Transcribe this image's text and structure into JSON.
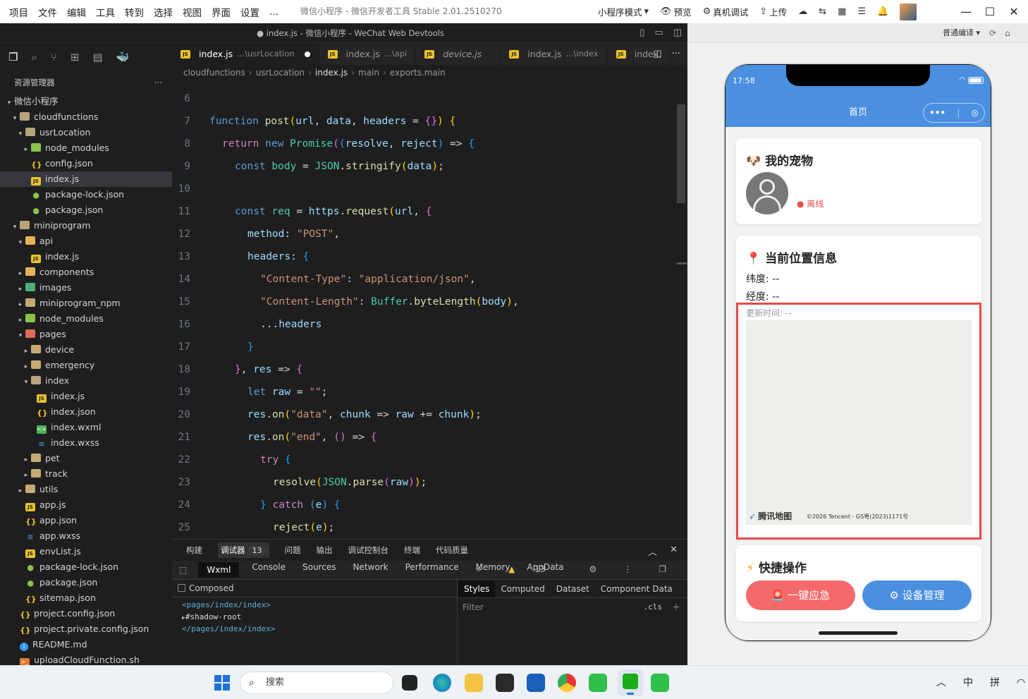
{
  "titlebar": {
    "menu": [
      "项目",
      "文件",
      "编辑",
      "工具",
      "转到",
      "选择",
      "视图",
      "界面",
      "设置",
      "..."
    ],
    "title": "微信小程序 - 微信开发者工具 Stable 2.01.2510270",
    "mode": "小程序模式",
    "preview": "预览",
    "real_debug": "真机调试",
    "upload": "上传"
  },
  "subbar": {
    "title": "● index.js - 微信小程序 - WeChat Web Devtools"
  },
  "simulator_top": {
    "compile": "普通编译"
  },
  "explorer": {
    "header": "资源管理器",
    "more": "···",
    "items": [
      {
        "label": "微信小程序",
        "depth": 0,
        "twisty": "▾",
        "icon": "none"
      },
      {
        "label": "cloudfunctions",
        "depth": 1,
        "twisty": "▾",
        "icon": "folder-open"
      },
      {
        "label": "usrLocation",
        "depth": 2,
        "twisty": "▾",
        "icon": "folder-open"
      },
      {
        "label": "node_modules",
        "depth": 3,
        "twisty": "▸",
        "icon": "folder-node"
      },
      {
        "label": "config.json",
        "depth": 3,
        "twisty": "",
        "icon": "json"
      },
      {
        "label": "index.js",
        "depth": 3,
        "twisty": "",
        "icon": "js",
        "selected": true
      },
      {
        "label": "package-lock.json",
        "depth": 3,
        "twisty": "",
        "icon": "pkg"
      },
      {
        "label": "package.json",
        "depth": 3,
        "twisty": "",
        "icon": "pkg"
      },
      {
        "label": "miniprogram",
        "depth": 1,
        "twisty": "▾",
        "icon": "folder-open"
      },
      {
        "label": "api",
        "depth": 2,
        "twisty": "▾",
        "icon": "api-folder"
      },
      {
        "label": "index.js",
        "depth": 3,
        "twisty": "",
        "icon": "js"
      },
      {
        "label": "components",
        "depth": 2,
        "twisty": "▸",
        "icon": "api-folder"
      },
      {
        "label": "images",
        "depth": 2,
        "twisty": "▸",
        "icon": "img-folder"
      },
      {
        "label": "miniprogram_npm",
        "depth": 2,
        "twisty": "▸",
        "icon": "folder"
      },
      {
        "label": "node_modules",
        "depth": 2,
        "twisty": "▸",
        "icon": "folder-node"
      },
      {
        "label": "pages",
        "depth": 2,
        "twisty": "▾",
        "icon": "red-folder"
      },
      {
        "label": "device",
        "depth": 3,
        "twisty": "▸",
        "icon": "folder"
      },
      {
        "label": "emergency",
        "depth": 3,
        "twisty": "▸",
        "icon": "folder"
      },
      {
        "label": "index",
        "depth": 3,
        "twisty": "▾",
        "icon": "folder-open"
      },
      {
        "label": "index.js",
        "depth": 4,
        "twisty": "",
        "icon": "js"
      },
      {
        "label": "index.json",
        "depth": 4,
        "twisty": "",
        "icon": "json"
      },
      {
        "label": "index.wxml",
        "depth": 4,
        "twisty": "",
        "icon": "wxml"
      },
      {
        "label": "index.wxss",
        "depth": 4,
        "twisty": "",
        "icon": "wxss"
      },
      {
        "label": "pet",
        "depth": 3,
        "twisty": "▸",
        "icon": "folder"
      },
      {
        "label": "track",
        "depth": 3,
        "twisty": "▸",
        "icon": "folder"
      },
      {
        "label": "utils",
        "depth": 2,
        "twisty": "▸",
        "icon": "folder"
      },
      {
        "label": "app.js",
        "depth": 2,
        "twisty": "",
        "icon": "js"
      },
      {
        "label": "app.json",
        "depth": 2,
        "twisty": "",
        "icon": "json"
      },
      {
        "label": "app.wxss",
        "depth": 2,
        "twisty": "",
        "icon": "wxss"
      },
      {
        "label": "envList.js",
        "depth": 2,
        "twisty": "",
        "icon": "js"
      },
      {
        "label": "package-lock.json",
        "depth": 2,
        "twisty": "",
        "icon": "pkg"
      },
      {
        "label": "package.json",
        "depth": 2,
        "twisty": "",
        "icon": "pkg"
      },
      {
        "label": "sitemap.json",
        "depth": 2,
        "twisty": "",
        "icon": "json"
      },
      {
        "label": "project.config.json",
        "depth": 1,
        "twisty": "",
        "icon": "json"
      },
      {
        "label": "project.private.config.json",
        "depth": 1,
        "twisty": "",
        "icon": "json"
      },
      {
        "label": "README.md",
        "depth": 1,
        "twisty": "",
        "icon": "info"
      },
      {
        "label": "uploadCloudFunction.sh",
        "depth": 1,
        "twisty": "",
        "icon": "sh"
      }
    ]
  },
  "tabs": [
    {
      "name": "index.js",
      "sub": "...\\usrLocation",
      "active": true,
      "dirty": true
    },
    {
      "name": "index.js",
      "sub": "...\\api"
    },
    {
      "name": "device.js",
      "sub": "",
      "italic": true
    },
    {
      "name": "index.js",
      "sub": "...\\index"
    },
    {
      "name": "index.",
      "sub": ""
    }
  ],
  "breadcrumb": [
    "cloudfunctions",
    "usrLocation",
    "index.js",
    "main",
    "exports.main"
  ],
  "code": [
    {
      "n": "6",
      "t": []
    },
    {
      "n": "7",
      "t": [
        [
          "k",
          "function "
        ],
        [
          "f",
          "post"
        ],
        [
          "p",
          "("
        ],
        [
          "v",
          "url"
        ],
        [
          "",
          "、 "
        ],
        [
          "v",
          "data"
        ],
        [
          "",
          ", "
        ],
        [
          "v",
          "headers"
        ],
        [
          "",
          " = "
        ],
        [
          "pp",
          "{}"
        ],
        [
          "p",
          ")"
        ],
        [
          "",
          " "
        ],
        [
          "p",
          "{"
        ]
      ]
    },
    {
      "n": "8",
      "t": [
        [
          "kp",
          "return "
        ],
        [
          "k",
          "new "
        ],
        [
          "c",
          "Promise"
        ],
        [
          "pp",
          "("
        ],
        [
          "pb",
          "("
        ],
        [
          "v",
          "resolve"
        ],
        [
          "",
          ", "
        ],
        [
          "v",
          "reject"
        ],
        [
          "pb",
          ")"
        ],
        [
          "",
          " => "
        ],
        [
          "pb",
          "{"
        ]
      ]
    },
    {
      "n": "9",
      "t": [
        [
          "k",
          "const "
        ],
        [
          "c",
          "body"
        ],
        [
          "",
          " = "
        ],
        [
          "c",
          "JSON"
        ],
        [
          "",
          "."
        ],
        [
          "f",
          "stringify"
        ],
        [
          "p",
          "("
        ],
        [
          "v",
          "data"
        ],
        [
          "p",
          ")"
        ],
        [
          ";"
        ]
      ]
    },
    {
      "n": "10",
      "t": []
    },
    {
      "n": "11",
      "t": [
        [
          "k",
          "const "
        ],
        [
          "c",
          "req"
        ],
        [
          "",
          " = "
        ],
        [
          "v",
          "https"
        ],
        [
          "",
          "."
        ],
        [
          "f",
          "request"
        ],
        [
          "p",
          "("
        ],
        [
          "v",
          "url"
        ],
        [
          "",
          ", "
        ],
        [
          "pp",
          "{"
        ]
      ]
    },
    {
      "n": "12",
      "t": [
        [
          "v",
          "method"
        ],
        [
          "",
          ": "
        ],
        [
          "s",
          "\"POST\""
        ],
        [
          ","
        ]
      ]
    },
    {
      "n": "13",
      "t": [
        [
          "v",
          "headers"
        ],
        [
          "",
          ": "
        ],
        [
          "pb",
          "{"
        ]
      ]
    },
    {
      "n": "14",
      "t": [
        [
          "s",
          "\"Content-Type\""
        ],
        [
          "",
          ": "
        ],
        [
          "s",
          "\"application/json\""
        ],
        [
          ","
        ]
      ]
    },
    {
      "n": "15",
      "t": [
        [
          "s",
          "\"Content-Length\""
        ],
        [
          "",
          ": "
        ],
        [
          "c",
          "Buffer"
        ],
        [
          "",
          "."
        ],
        [
          "f",
          "byteLength"
        ],
        [
          "p",
          "("
        ],
        [
          "v",
          "body"
        ],
        [
          "p",
          ")"
        ],
        [
          ","
        ]
      ]
    },
    {
      "n": "16",
      "t": [
        [
          "",
          "..."
        ],
        [
          "v",
          "headers"
        ]
      ]
    },
    {
      "n": "17",
      "t": [
        [
          "pb",
          "}"
        ]
      ]
    },
    {
      "n": "18",
      "t": [
        [
          "pp",
          "}"
        ],
        [
          "",
          ", "
        ],
        [
          "v",
          "res"
        ],
        [
          "",
          " => "
        ],
        [
          "pp",
          "{"
        ]
      ]
    },
    {
      "n": "19",
      "t": [
        [
          "k",
          "let "
        ],
        [
          "v",
          "raw"
        ],
        [
          "",
          " = "
        ],
        [
          "s",
          "\"\""
        ],
        [
          ";"
        ]
      ]
    },
    {
      "n": "20",
      "t": [
        [
          "v",
          "res"
        ],
        [
          "",
          "."
        ],
        [
          "f",
          "on"
        ],
        [
          "p",
          "("
        ],
        [
          "s",
          "\"data\""
        ],
        [
          "",
          ", "
        ],
        [
          "v",
          "chunk"
        ],
        [
          "",
          " => "
        ],
        [
          "v",
          "raw"
        ],
        [
          "",
          " += "
        ],
        [
          "v",
          "chunk"
        ],
        [
          "p",
          ")"
        ],
        [
          ";"
        ]
      ]
    },
    {
      "n": "21",
      "t": [
        [
          "v",
          "res"
        ],
        [
          "",
          "."
        ],
        [
          "f",
          "on"
        ],
        [
          "p",
          "("
        ],
        [
          "s",
          "\"end\""
        ],
        [
          "",
          ", "
        ],
        [
          "pp",
          "()"
        ],
        [
          "",
          " => "
        ],
        [
          "pp",
          "{"
        ]
      ]
    },
    {
      "n": "22",
      "t": [
        [
          "kp",
          "try "
        ],
        [
          "pb",
          "{"
        ]
      ]
    },
    {
      "n": "23",
      "t": [
        [
          "f",
          "resolve"
        ],
        [
          "p",
          "("
        ],
        [
          "c",
          "JSON"
        ],
        [
          "",
          "."
        ],
        [
          "f",
          "parse"
        ],
        [
          "pp",
          "("
        ],
        [
          "v",
          "raw"
        ],
        [
          "pp",
          ")"
        ],
        [
          "p",
          ")"
        ],
        [
          ";"
        ]
      ]
    },
    {
      "n": "24",
      "t": [
        [
          "pb",
          "} "
        ],
        [
          "kp",
          "catch "
        ],
        [
          "pb",
          "("
        ],
        [
          "v",
          "e"
        ],
        [
          "pb",
          ") "
        ],
        [
          "pb",
          "{"
        ]
      ]
    },
    {
      "n": "25",
      "t": [
        [
          "f",
          "reject"
        ],
        [
          "p",
          "("
        ],
        [
          "v",
          "e"
        ],
        [
          "p",
          ")"
        ],
        [
          ";"
        ]
      ]
    }
  ],
  "panel": {
    "tabs": [
      "构建",
      "调试器",
      "问题",
      "输出",
      "调试控制台",
      "终端",
      "代码质量"
    ],
    "debugger_badge": "13",
    "devtools_tabs": [
      "Wxml",
      "Console",
      "Sources",
      "Network",
      "Performance",
      "Memory",
      "AppData"
    ],
    "warnings": "13",
    "composed": "Composed",
    "dom": [
      "<pages/index/index>",
      "#shadow-root",
      "</pages/index/index>"
    ],
    "style_tabs": [
      "Styles",
      "Computed",
      "Dataset",
      "Component Data"
    ],
    "filter_placeholder": "Filter",
    "cls": ".cls"
  },
  "phone": {
    "time": "17:58",
    "nav_title": "首页",
    "pet_card_title": "我的宠物",
    "pet_emoji": "🐶",
    "pet_status": "● 离线",
    "location_title": "当前位置信息",
    "location_emoji": "📍",
    "latitude": "纬度: --",
    "longitude": "经度: --",
    "updated": "更新时间: --",
    "map_logo": "腾讯地图",
    "map_copyright": "©2026 Tencent - GS粤(2023)1171号",
    "quick_title": "快捷操作",
    "quick_emoji": "⚡",
    "btn_emergency": "🚨 一键应急",
    "btn_device": "⚙ 设备管理",
    "colors": {
      "primary": "#4a8fe0",
      "danger": "#f46a6a",
      "frame": "#e84a4a"
    }
  },
  "taskbar": {
    "search": "搜索",
    "ime1": "中",
    "ime2": "拼",
    "chevron": "^"
  }
}
